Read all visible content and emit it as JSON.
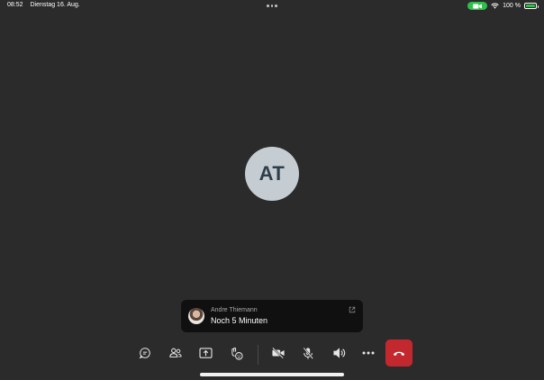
{
  "status_bar": {
    "time": "08:52",
    "date": "Dienstag 16. Aug.",
    "battery": "100 %",
    "battery_level": 1.0
  },
  "call": {
    "participant_initials": "AT"
  },
  "notification": {
    "sender": "Andre Thiemann",
    "message": "Noch 5 Minuten"
  },
  "toolbar": {
    "icons": [
      "chat-icon",
      "people-icon",
      "share-screen-icon",
      "reactions-icon",
      "camera-off-icon",
      "mic-off-icon",
      "speaker-icon",
      "more-icon",
      "hang-up-icon"
    ],
    "end_call_color": "#c4282f"
  },
  "colors": {
    "background": "#2b2b2b",
    "avatar_bg": "#c5cdd3",
    "camera_indicator": "#2fbf4a"
  }
}
